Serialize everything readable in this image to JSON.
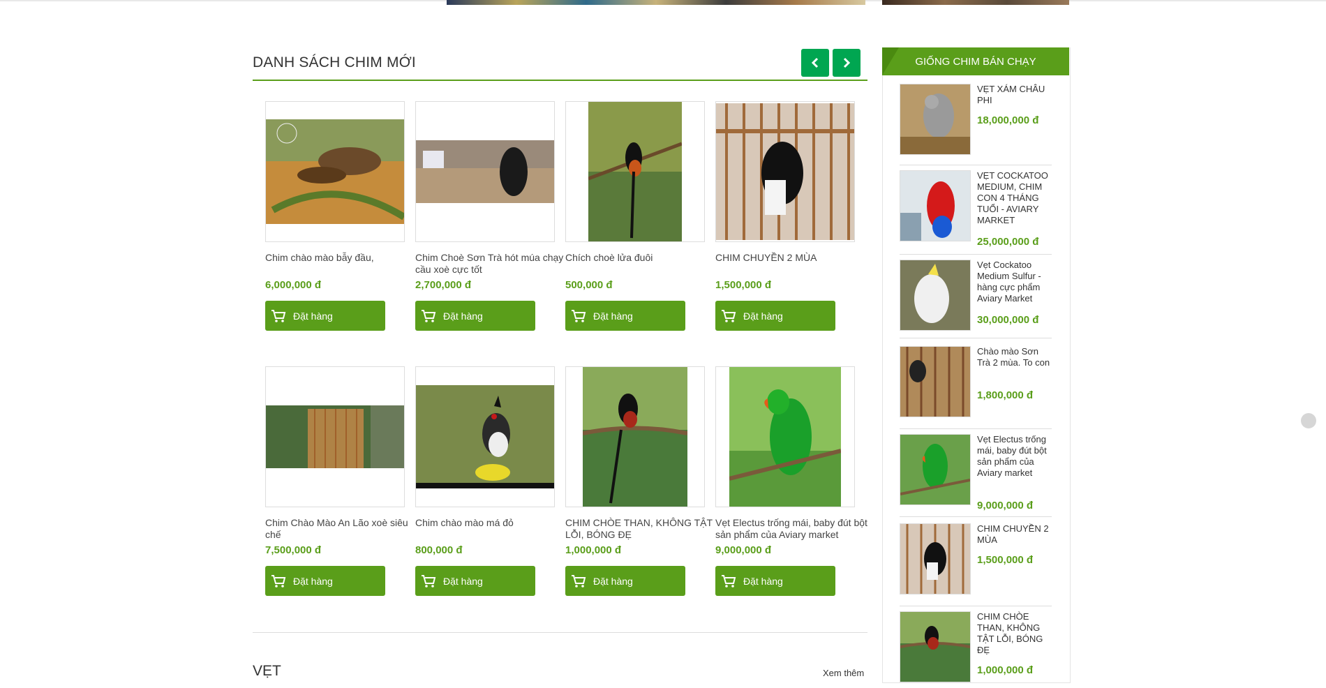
{
  "section": {
    "title": "DANH SÁCH CHIM MỚI"
  },
  "order_label": "Đặt hàng",
  "products": [
    {
      "name": "Chim chào mào bẫy đầu,",
      "price": "6,000,000 đ"
    },
    {
      "name": "Chim Choè Sơn Trà hót múa chạy cầu xoè cực tốt",
      "price": "2,700,000 đ"
    },
    {
      "name": "Chích choè lửa đuôi",
      "price": "500,000 đ"
    },
    {
      "name": "CHIM CHUYỀN 2 MÙA",
      "price": "1,500,000 đ"
    },
    {
      "name": "Chim Chào Mào An Lão xoè siêu chế",
      "price": "7,500,000 đ"
    },
    {
      "name": "Chim chào mào má đỏ",
      "price": "800,000 đ"
    },
    {
      "name": "CHIM CHÒE THAN, KHÔNG TẬT LỖI, BÓNG ĐẸ",
      "price": "1,000,000 đ"
    },
    {
      "name": "Vẹt Electus trống mái, baby đút bột sản phẩm của Aviary market",
      "price": "9,000,000 đ"
    }
  ],
  "next_section": {
    "title": "VẸT",
    "see_more": "Xem thêm"
  },
  "sidebar": {
    "title": "GIỐNG CHIM BÁN CHẠY",
    "items": [
      {
        "name": "VẸT XÁM CHÂU PHI",
        "price": "18,000,000 đ"
      },
      {
        "name": "VẸT COCKATOO MEDIUM, CHIM CON 4 THÁNG TUỔI - AVIARY MARKET",
        "price": "25,000,000 đ"
      },
      {
        "name": "Vẹt Cockatoo Medium Sulfur - hàng cực phẩm Aviary Market",
        "price": "30,000,000 đ"
      },
      {
        "name": "Chào mào Sơn Trà 2 mùa. To con",
        "price": "1,800,000 đ"
      },
      {
        "name": "Vẹt Electus trống mái, baby đút bột sản phẩm của Aviary market",
        "price": "9,000,000 đ"
      },
      {
        "name": "CHIM CHUYỀN 2 MÙA",
        "price": "1,500,000 đ"
      },
      {
        "name": "CHIM CHÒE THAN, KHÔNG TẬT LỖI, BÓNG ĐẸ",
        "price": "1,000,000 đ"
      }
    ]
  },
  "colors": {
    "accent": "#5a9e1a",
    "nav": "#00a651"
  },
  "icons": {
    "prev": "chevron-left-icon",
    "next": "chevron-right-icon",
    "cart": "cart-icon"
  }
}
